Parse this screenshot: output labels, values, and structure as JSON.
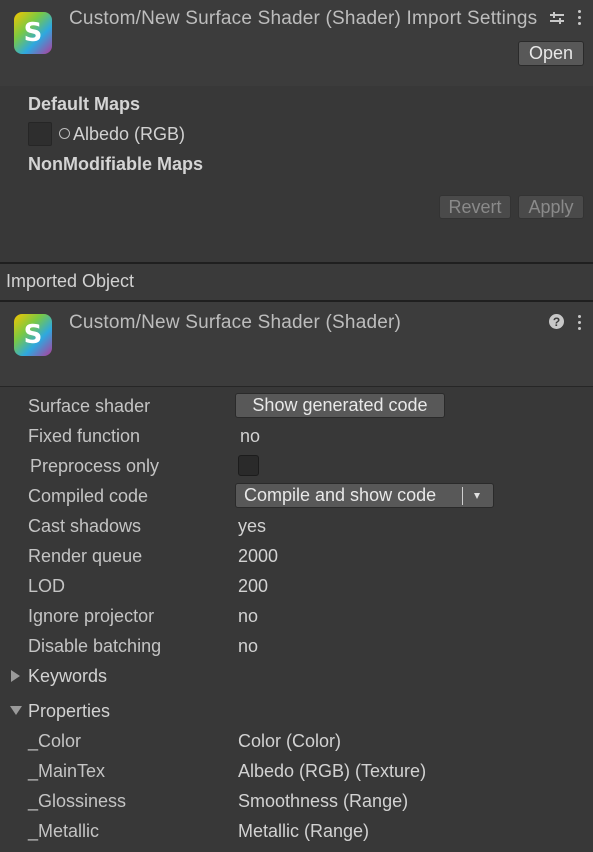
{
  "header": {
    "title": "Custom/New Surface Shader (Shader) Import Settings",
    "open_label": "Open",
    "icons": [
      "shader-logo-icon",
      "sliders-icon",
      "kebab-menu-icon"
    ]
  },
  "maps": {
    "default_heading": "Default Maps",
    "albedo_label": "Albedo (RGB)",
    "nonmodifiable_heading": "NonModifiable Maps"
  },
  "actions": {
    "revert_label": "Revert",
    "apply_label": "Apply"
  },
  "imported": {
    "section_title": "Imported Object",
    "title": "Custom/New Surface Shader (Shader)",
    "logo_letter": "S"
  },
  "props": {
    "surface_shader_label": "Surface shader",
    "show_generated_label": "Show generated code",
    "fixed_function_label": "Fixed function",
    "fixed_function_value": "no",
    "preprocess_label": "Preprocess only",
    "compiled_code_label": "Compiled code",
    "compile_button_label": "Compile and show code",
    "cast_shadows_label": "Cast shadows",
    "cast_shadows_value": "yes",
    "render_queue_label": "Render queue",
    "render_queue_value": "2000",
    "lod_label": "LOD",
    "lod_value": "200",
    "ignore_projector_label": "Ignore projector",
    "ignore_projector_value": "no",
    "disable_batching_label": "Disable batching",
    "disable_batching_value": "no",
    "keywords_label": "Keywords",
    "properties_label": "Properties"
  },
  "properties_list": [
    {
      "name": "_Color",
      "value": "Color (Color)"
    },
    {
      "name": "_MainTex",
      "value": "Albedo (RGB) (Texture)"
    },
    {
      "name": "_Glossiness",
      "value": "Smoothness (Range)"
    },
    {
      "name": "_Metallic",
      "value": "Metallic (Range)"
    }
  ],
  "colors": {
    "background": "#383838",
    "header": "#3c3c3c",
    "button": "#585858"
  }
}
